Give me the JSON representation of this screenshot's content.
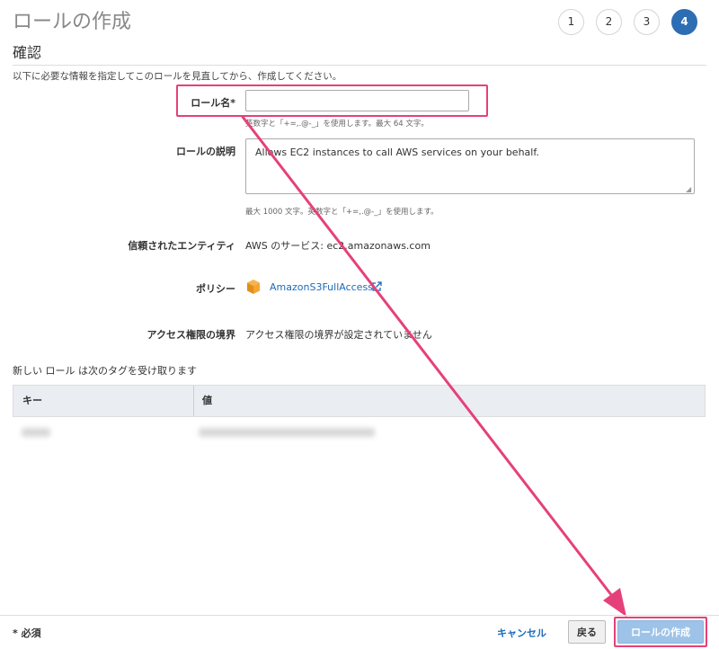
{
  "header": {
    "title": "ロールの作成",
    "steps": [
      "1",
      "2",
      "3",
      "4"
    ],
    "active_step": "4"
  },
  "section": {
    "title": "確認",
    "description": "以下に必要な情報を指定してこのロールを見直してから、作成してください。"
  },
  "form": {
    "role_name_label": "ロール名*",
    "role_name_value": "",
    "role_name_hint": "英数字と「+=,.@-_」を使用します。最大 64 文字。",
    "role_desc_label": "ロールの説明",
    "role_desc_value": "Allows EC2 instances to call AWS services on your behalf.",
    "role_desc_hint": "最大 1000 文字。英数字と「+=,.@-_」を使用します。",
    "trusted_label": "信頼されたエンティティ",
    "trusted_value": "AWS のサービス: ec2.amazonaws.com",
    "policy_label": "ポリシー",
    "policy_link": "AmazonS3FullAccess",
    "boundary_label": "アクセス権限の境界",
    "boundary_value": "アクセス権限の境界が設定されていません"
  },
  "tags": {
    "title": "新しい ロール は次のタグを受け取ります",
    "columns": [
      "キー",
      "値"
    ]
  },
  "footer": {
    "required_note": "* 必須",
    "cancel": "キャンセル",
    "back": "戻る",
    "create": "ロールの作成"
  },
  "icons": {
    "policy": "aws-box-icon",
    "external": "external-link-icon"
  },
  "colors": {
    "accent": "#2d6db4",
    "link": "#1a6bb8",
    "highlight": "#e6407a",
    "primary_disabled": "#9ec3e8"
  }
}
